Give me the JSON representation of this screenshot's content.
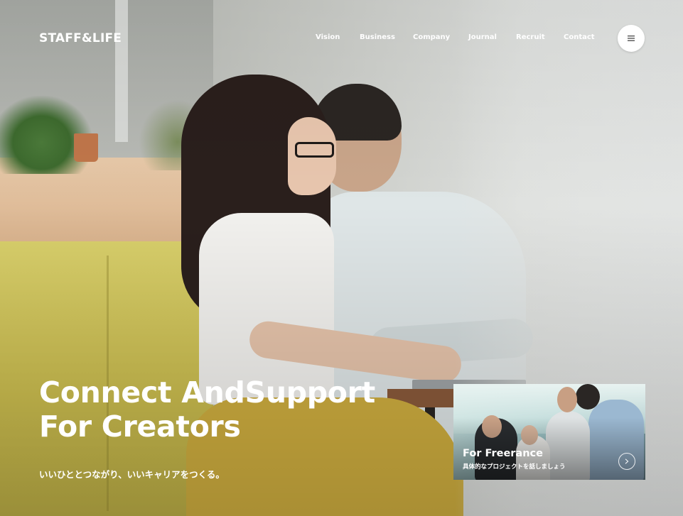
{
  "header": {
    "logo": "STAFF&LIFE",
    "nav": [
      "Vision",
      "Business",
      "Company",
      "Journal",
      "Recruit",
      "Contact"
    ],
    "menu_icon": "hamburger-menu-icon"
  },
  "hero": {
    "headline_line1": "Connect AndSupport",
    "headline_line2": "For Creators",
    "tagline": "いいひととつながり、いいキャリアをつくる。"
  },
  "promo_card": {
    "title": "For Freerance",
    "subtitle": "具体的なプロジェクトを話しましょう",
    "arrow_icon": "chevron-right-icon"
  },
  "colors": {
    "text_on_image": "#ffffff",
    "menu_button_bg": "#ffffff"
  }
}
